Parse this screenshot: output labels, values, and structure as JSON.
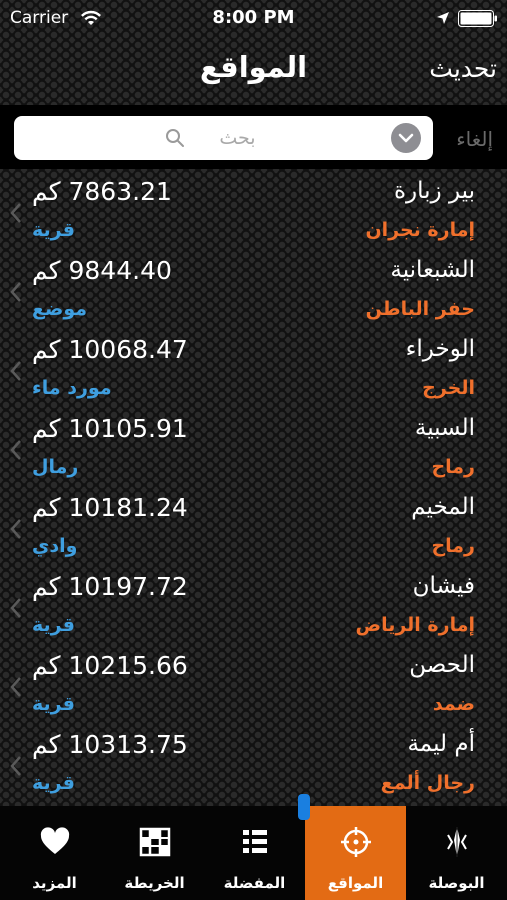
{
  "status_bar": {
    "carrier": "Carrier",
    "time": "8:00 PM"
  },
  "nav": {
    "title": "المواقع",
    "refresh_label": "تحديث"
  },
  "search": {
    "placeholder": "بحث",
    "cancel_label": "إلغاء"
  },
  "rows": [
    {
      "name": "بير زبارة",
      "region": "إمارة نجران",
      "distance": "7863.21 كم",
      "type": "قرية"
    },
    {
      "name": "الشبعانية",
      "region": "حفر الباطن",
      "distance": "9844.40 كم",
      "type": "موضع"
    },
    {
      "name": "الوخراء",
      "region": "الخرج",
      "distance": "10068.47 كم",
      "type": "مورد ماء"
    },
    {
      "name": "السبية",
      "region": "رماح",
      "distance": "10105.91 كم",
      "type": "رمال"
    },
    {
      "name": "المخيم",
      "region": "رماح",
      "distance": "10181.24 كم",
      "type": "وادي"
    },
    {
      "name": "فيشان",
      "region": "إمارة الرياض",
      "distance": "10197.72 كم",
      "type": "قرية"
    },
    {
      "name": "الحصن",
      "region": "ضمد",
      "distance": "10215.66 كم",
      "type": "قرية"
    },
    {
      "name": "أم ليمة",
      "region": "رجال ألمع",
      "distance": "10313.75 كم",
      "type": "قرية"
    }
  ],
  "tabs": [
    {
      "label": "البوصلة",
      "icon": "compass-icon"
    },
    {
      "label": "المواقع",
      "icon": "crosshair-icon",
      "active": true
    },
    {
      "label": "المفضلة",
      "icon": "grid-list-icon"
    },
    {
      "label": "الخريطة",
      "icon": "map-icon"
    },
    {
      "label": "المزيد",
      "icon": "heart-icon"
    }
  ],
  "colors": {
    "accent": "#e36b14",
    "region": "#f0702c",
    "type": "#3f9fe0"
  }
}
